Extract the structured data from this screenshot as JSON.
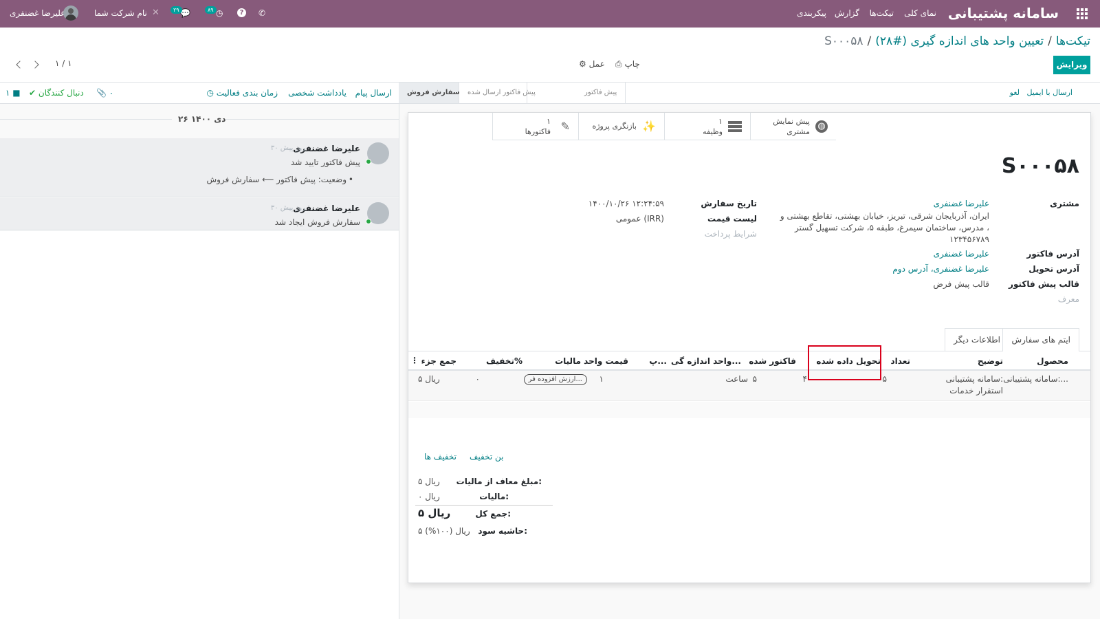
{
  "topbar": {
    "app_title": "سامانه پشتیبانی",
    "menu": [
      "نمای کلی",
      "تیکت‌ها",
      "گزارش",
      "پیکربندی"
    ],
    "user_name": "علیرضا غضنفری",
    "company": "نام شرکت شما",
    "badge_messages": "۲۹",
    "badge_activities": "۸۹",
    "help_icon": "question-circle-icon",
    "phone_icon": "phone-icon"
  },
  "breadcrumb": {
    "root": "تیکت‌ها",
    "parent": "تعیین واحد های اندازه گیری (#۲۸)",
    "current": "S۰۰۰۵۸"
  },
  "toolbar": {
    "edit": "ویرایش",
    "print": "چاپ",
    "action": "عمل",
    "pager": "۱ / ۱"
  },
  "statusbar": {
    "send_email": "ارسال با ایمیل",
    "cancel": "لغو",
    "stages": [
      "پیش فاکتور",
      "پیش فاکتور ارسال شده",
      "سفارش فروش"
    ],
    "active_stage": "سفارش فروش"
  },
  "smart_buttons": {
    "preview_line1": "پیش نمایش",
    "preview_line2": "مشتری",
    "tasks_count": "۱",
    "tasks_label": "وظیفه",
    "project": "بازنگری پروژه",
    "invoices_count": "۱",
    "invoices_label": "فاکتورها"
  },
  "order": {
    "name": "S۰۰۰۵۸",
    "customer_label": "مشتری",
    "customer": "علیرضا غضنفری",
    "address_line1": "ایران، آذربایجان شرقی، تبریز، خیابان بهشتی، تقاطع بهشتی و",
    "address_line2": "مدرس، ساختمان سیمرغ، طبقه ۵، شرکت تسهیل گستر ،",
    "address_line3": "۱۲۳۴۵۶۷۸۹",
    "invoice_address_label": "آدرس فاکتور",
    "invoice_address": "علیرضا غضنفری",
    "delivery_address_label": "آدرس تحویل",
    "delivery_address": "علیرضا غضنفری، آدرس دوم",
    "template_label": "قالب پیش فاکتور",
    "template": "قالب پیش فرض",
    "referrer_label": "معرف",
    "date_label": "تاریخ سفارش",
    "date": "۱۴۰۰/۱۰/۲۶ ۱۲:۲۴:۵۹",
    "pricelist_label": "لیست قیمت",
    "pricelist": "عمومی (IRR)",
    "payment_terms_label": "شرایط پرداخت"
  },
  "tabs": [
    "ایتم های سفارش",
    "اطلاعات دیگر"
  ],
  "table": {
    "headers": [
      "محصول",
      "توضیح",
      "تعداد",
      "تحویل داده شده",
      "فاکتور شده",
      "واحد اندازه گی...",
      "پ...",
      "قیمت واحد",
      "مالیات",
      "تخفیف%",
      "جمع جزء"
    ],
    "row": {
      "product": "سامانه پشتیبانی:...",
      "desc_line1": "سامانه پشتیبانی:",
      "desc_line2": "استقرار خدمات",
      "qty": "۵",
      "delivered": "۴",
      "invoiced": "۵",
      "uom": "ساعت",
      "price": "۱",
      "tax": "ارزش افزوده فر...",
      "discount": "۰",
      "subtotal": "۵ ریال"
    }
  },
  "coupon": {
    "coupon_link": "بن تخفیف",
    "promotions_link": "تخفیف ها"
  },
  "totals": {
    "untaxed_label": "مبلغ معاف از مالیات:",
    "untaxed": "۵ ریال",
    "tax_label": "مالیات:",
    "tax": "۰ ریال",
    "total_label": "جمع کل:",
    "total": "۵ ریال",
    "margin_label": "حاشیه سود:",
    "margin": "۵ ریال (۱۰۰%)"
  },
  "chatter": {
    "send_message": "ارسال پیام",
    "log_note": "یادداشت شخصی",
    "schedule_activity": "زمان بندی فعالیت",
    "attachments": "۰",
    "following": "دنبال کنندگان",
    "followers_count": "۱",
    "date_separator": "۲۶ دی ۱۴۰۰",
    "messages": [
      {
        "author": "علیرضا غضنفری",
        "date": "۳۰ روز پیش",
        "body": "پیش فاکتور تایید شد",
        "tracking": "وضعیت: پیش فاکتور ⟵ سفارش فروش"
      },
      {
        "author": "علیرضا غضنفری",
        "date": "۳۰ روز پیش",
        "body": "سفارش فروش ایجاد شد"
      }
    ]
  },
  "colors": {
    "brand": "#875a7b",
    "accent": "#00a09d",
    "link": "#017e84",
    "highlight": "#d9001b"
  }
}
